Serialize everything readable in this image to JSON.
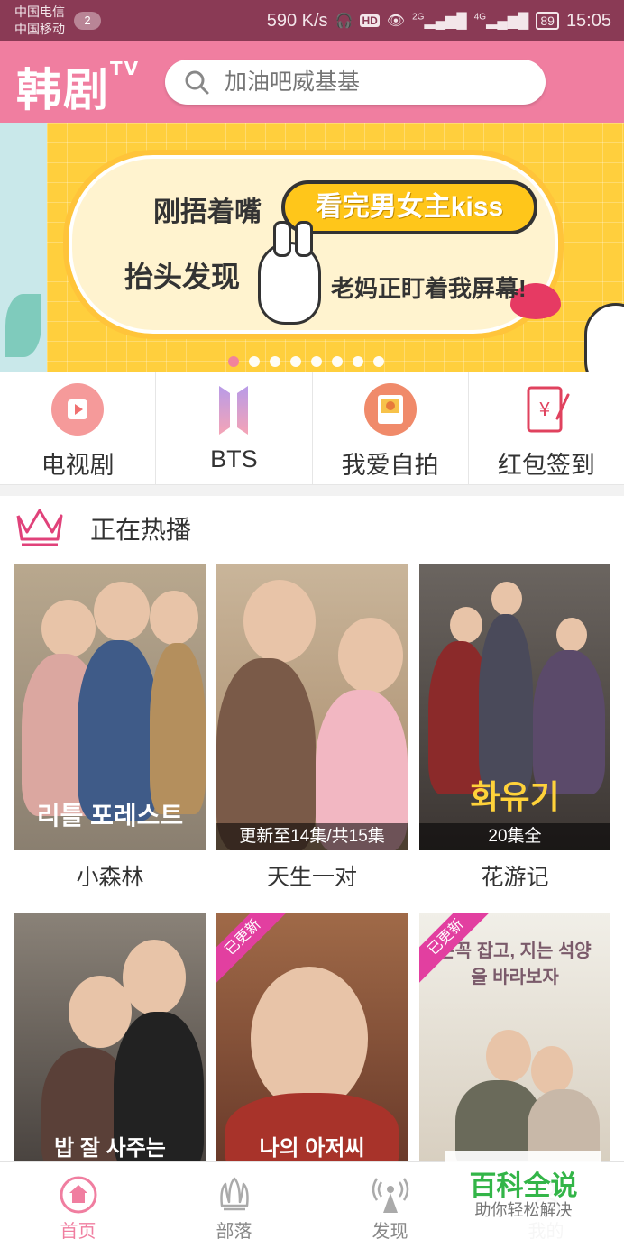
{
  "status_bar": {
    "carrier_1": "中国电信",
    "carrier_2": "中国移动",
    "sim_badge": "2",
    "speed": "590 K/s",
    "hd_badge": "HD",
    "net1": "2G",
    "net2": "4G",
    "battery": "89",
    "time": "15:05"
  },
  "header": {
    "logo_text": "韩剧",
    "logo_sup": "TV",
    "search_placeholder": "加油吧威基基"
  },
  "banner": {
    "line1": "刚捂着嘴",
    "highlight": "看完男女主kiss",
    "line2": "抬头发现",
    "line3": "老妈正盯着我屏幕!",
    "dot_count": 8,
    "active_dot": 0
  },
  "quick_menu": [
    {
      "label": "电视剧",
      "icon": "tv-play-icon"
    },
    {
      "label": "BTS",
      "icon": "bts-logo-icon"
    },
    {
      "label": "我爱自拍",
      "icon": "selfie-icon"
    },
    {
      "label": "红包签到",
      "icon": "red-packet-icon"
    }
  ],
  "section": {
    "title": "正在热播"
  },
  "dramas": [
    {
      "title": "小森林",
      "caption": "",
      "poster_text": "리틀 포레스트",
      "badge": ""
    },
    {
      "title": "天生一对",
      "caption": "更新至14集/共15集",
      "poster_text": "",
      "badge": ""
    },
    {
      "title": "花游记",
      "caption": "20集全",
      "poster_text": "화유기",
      "badge": ""
    },
    {
      "title": "",
      "caption": "",
      "poster_text": "밥 잘 사주는",
      "badge": ""
    },
    {
      "title": "",
      "caption": "",
      "poster_text": "나의 아저씨",
      "badge": "已更新"
    },
    {
      "title": "",
      "caption": "",
      "poster_text": "손꼭 잡고, 지는 석양을 바라보자",
      "badge": "已更新"
    }
  ],
  "bottom_nav": [
    {
      "label": "首页",
      "icon": "home-icon",
      "active": true
    },
    {
      "label": "部落",
      "icon": "tribe-icon",
      "active": false
    },
    {
      "label": "发现",
      "icon": "discover-icon",
      "active": false
    },
    {
      "label": "我的",
      "icon": "profile-icon",
      "active": false
    }
  ],
  "watermark": {
    "main": "百科全说",
    "sub": "助你轻松解决"
  },
  "colors": {
    "brand_pink": "#f07ea0",
    "status_bar": "#8a3a55",
    "banner_yellow": "#ffcf3d"
  }
}
